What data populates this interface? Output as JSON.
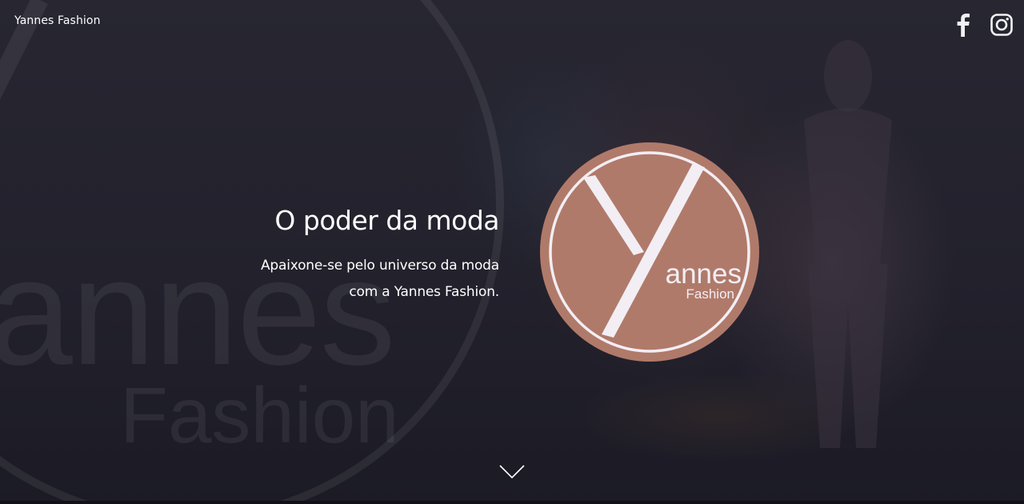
{
  "header": {
    "brand": "Yannes Fashion",
    "social": [
      {
        "name": "facebook",
        "icon": "facebook-icon"
      },
      {
        "name": "instagram",
        "icon": "instagram-icon"
      }
    ]
  },
  "hero": {
    "title": "O poder da moda",
    "subtitle_line1": "Apaixone-se pelo universo da moda",
    "subtitle_line2": "com a Yannes Fashion.",
    "background_watermark": {
      "word1": "annes",
      "word2": "Fashion"
    },
    "logo": {
      "wordmark": "annes",
      "tagline": "Fashion",
      "fill_color": "#b07a6a",
      "stroke_color": "#f2eef4"
    },
    "scroll_icon": "chevron-down-icon"
  }
}
